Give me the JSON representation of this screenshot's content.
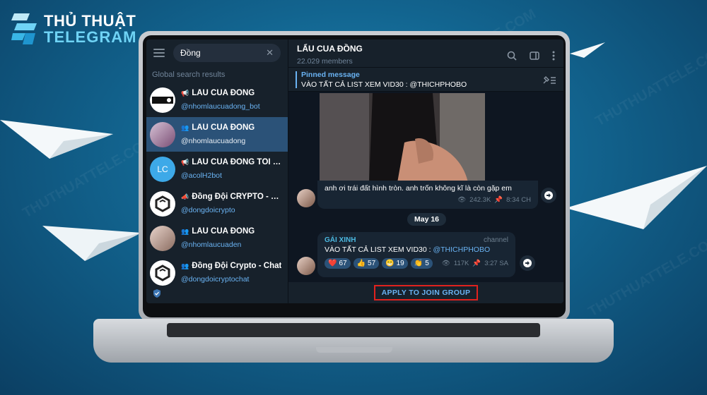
{
  "brand": {
    "line1": "THỦ THUẬT",
    "line2": "TELEGRAM",
    "watermark_text": "THUTHUATTELE.COM"
  },
  "colors": {
    "accent": "#6ab3f3",
    "sidebar_bg": "#17212b",
    "chat_bg": "#0e1621",
    "active_item": "#2b5278",
    "highlight_box": "#e0221e"
  },
  "sidebar": {
    "search": {
      "value": "Đồng"
    },
    "section_label": "Global search results",
    "results": [
      {
        "kind_icon": "megaphone-icon",
        "title": "LẨU CUA ĐỒNG",
        "subtitle": "@nhomlaucuadong_bot",
        "avatar_text": "",
        "active": false
      },
      {
        "kind_icon": "group-icon",
        "title": "LẨU CUA ĐỒNG",
        "subtitle": "@nhomlaucuadong",
        "avatar_text": "",
        "active": true
      },
      {
        "kind_icon": "megaphone-icon",
        "title": "LẨU CUA ĐỒNG TỐI CỔ",
        "subtitle": "@acolH2bot",
        "avatar_text": "LC",
        "active": false
      },
      {
        "kind_icon": "broadcast-icon",
        "title": "Đồng Đội CRYPTO - Chan...",
        "subtitle": "@dongdoicrypto",
        "avatar_text": "",
        "active": false
      },
      {
        "kind_icon": "group-icon",
        "title": "LẨU CUA ĐỒNG",
        "subtitle": "@nhomlaucuaden",
        "avatar_text": "",
        "active": false
      },
      {
        "kind_icon": "group-icon",
        "title": "Đồng Đội Crypto - Chat",
        "subtitle": "@dongdoicryptochat",
        "avatar_text": "",
        "active": false
      }
    ]
  },
  "chat": {
    "title": "LẨU CUA ĐỒNG",
    "members": "22.029 members",
    "pinned": {
      "label": "Pinned message",
      "text": "VÀO TẤT CẢ LIST XEM VID30 : @THICHPHOBO"
    },
    "message1": {
      "text": "anh ơi trái đất hình tròn. anh trốn không kĩ là còn gặp em",
      "views": "242.3K",
      "time": "8:34 CH"
    },
    "date_separator": "May 16",
    "message2": {
      "sender": "GÁI XINH",
      "tag": "channel",
      "text_prefix": "VÀO TẤT CẢ LIST XEM VID30 : ",
      "text_link": "@THICHPHOBO",
      "reactions": [
        {
          "emoji": "❤️",
          "count": "67"
        },
        {
          "emoji": "👍",
          "count": "57"
        },
        {
          "emoji": "😁",
          "count": "19"
        },
        {
          "emoji": "👏",
          "count": "5"
        }
      ],
      "views": "117K",
      "time": "3:27 SA"
    },
    "join_button": "APPLY TO JOIN GROUP"
  }
}
